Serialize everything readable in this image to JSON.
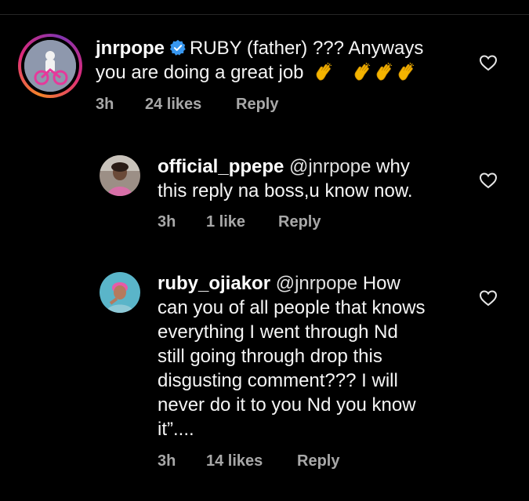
{
  "colors": {
    "background": "#000000",
    "text": "#f5f5f5",
    "meta": "#a8a8a8",
    "verified": "#3897f0"
  },
  "comments": [
    {
      "username": "jnrpope",
      "verified": true,
      "text_line1": "RUBY (father) ??? Anyways",
      "text_line2": "you are doing a great job",
      "emoji": [
        "clapping-hands",
        "clapping-hands",
        "clapping-hands",
        "clapping-hands"
      ],
      "time": "3h",
      "likes": "24 likes",
      "reply": "Reply"
    },
    {
      "username": "official_ppepe",
      "mention": "@jnrpope",
      "text_line1": " why",
      "text_line2": "this reply na boss,u know now.",
      "time": "3h",
      "likes": "1 like",
      "reply": "Reply"
    },
    {
      "username": "ruby_ojiakor",
      "mention": "@jnrpope",
      "text_line1": " How",
      "lines": [
        "can you of all people that knows",
        "everything I went through Nd",
        "still going through drop this",
        "disgusting comment??? I will",
        "never do it to you Nd you know",
        "it”...."
      ],
      "time": "3h",
      "likes": "14 likes",
      "reply": "Reply"
    }
  ]
}
